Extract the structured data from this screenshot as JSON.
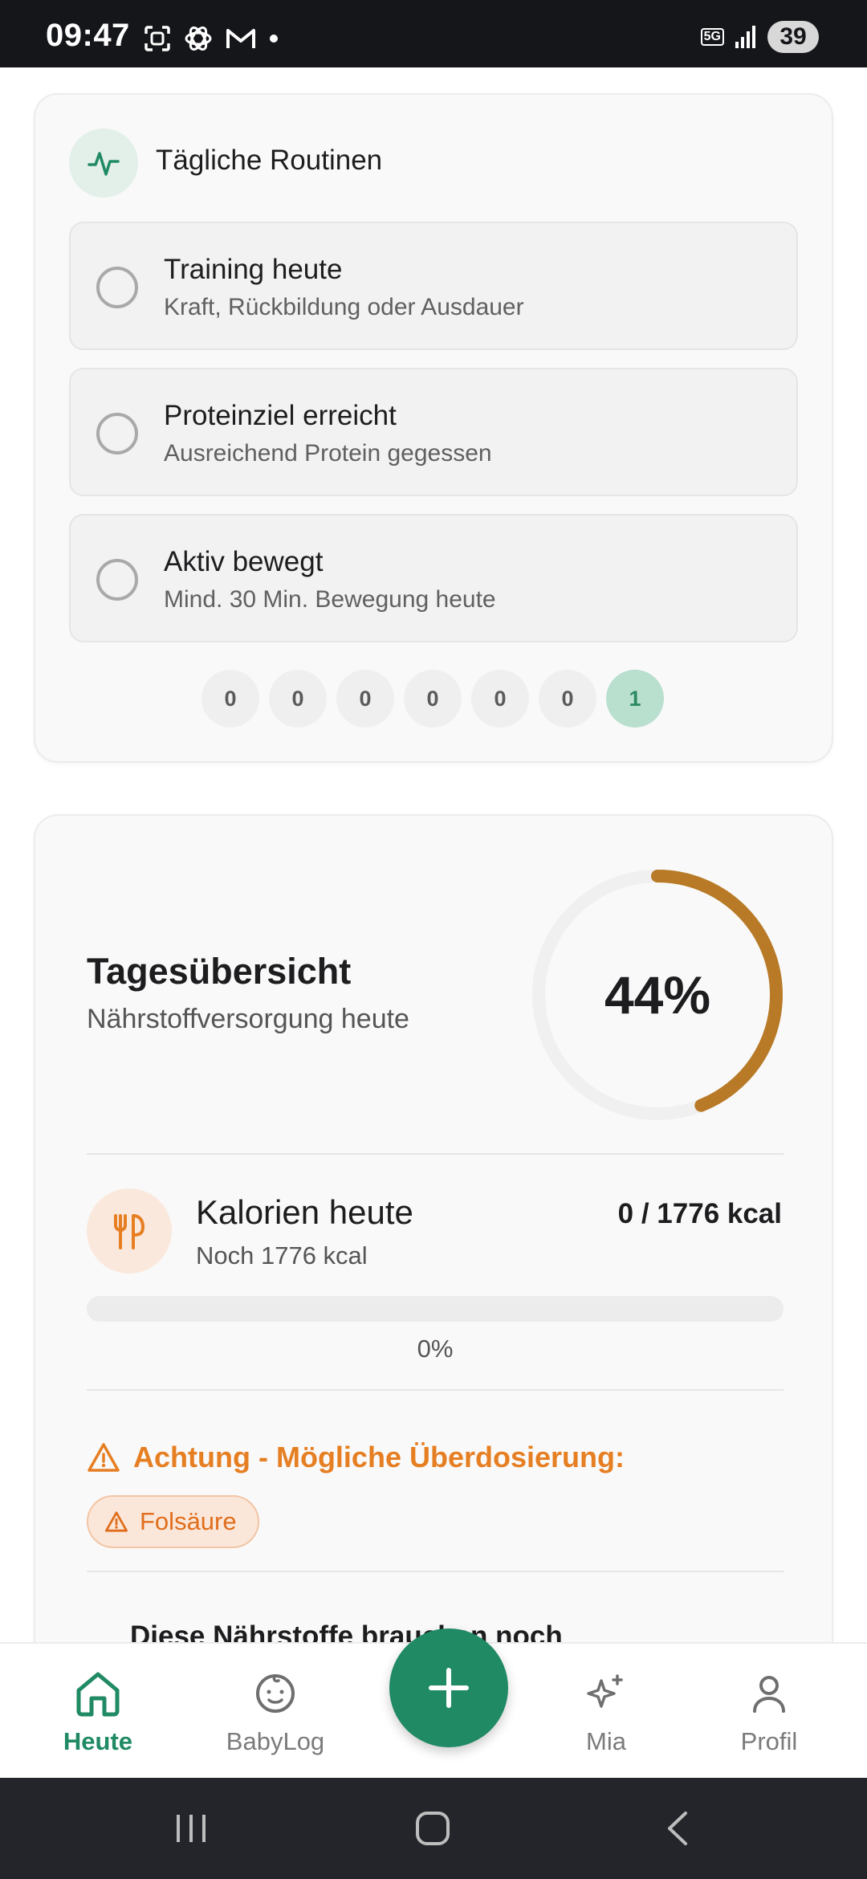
{
  "status_bar": {
    "time": "09:47",
    "notification_icons": [
      "scan-icon",
      "openai-icon",
      "gmail-icon",
      "dot-icon"
    ],
    "network": "5G",
    "battery": "39"
  },
  "routines": {
    "title": "Tägliche Routinen",
    "items": [
      {
        "label": "Training heute",
        "sub": "Kraft, Rückbildung oder Ausdauer"
      },
      {
        "label": "Proteinziel erreicht",
        "sub": "Ausreichend Protein gegessen"
      },
      {
        "label": "Aktiv bewegt",
        "sub": "Mind. 30 Min. Bewegung heute"
      }
    ],
    "days": [
      "0",
      "0",
      "0",
      "0",
      "0",
      "0",
      "1"
    ],
    "active_day_index": 6
  },
  "overview": {
    "title": "Tagesübersicht",
    "subtitle": "Nährstoffversorgung heute",
    "percent_label": "44%",
    "percent_value": 44,
    "ring_color": "#b87a26",
    "kcal": {
      "title": "Kalorien heute",
      "sub": "Noch 1776 kcal",
      "value": "0 / 1776 kcal",
      "progress_label": "0%",
      "progress_value": 0
    },
    "warning": {
      "text": "Achtung - Mögliche Überdosierung:",
      "chip": "Folsäure"
    },
    "more_text": "Diese Nährstoffe brauchen noch"
  },
  "bottom_nav": {
    "items": [
      {
        "label": "Heute",
        "icon": "home-icon",
        "active": true
      },
      {
        "label": "BabyLog",
        "icon": "baby-icon",
        "active": false
      },
      {
        "label": "Mia",
        "icon": "sparkle-icon",
        "active": false
      },
      {
        "label": "Profil",
        "icon": "user-icon",
        "active": false
      }
    ],
    "fab_icon": "plus-icon"
  },
  "colors": {
    "accent": "#1f8a63",
    "warning": "#e67e22"
  }
}
